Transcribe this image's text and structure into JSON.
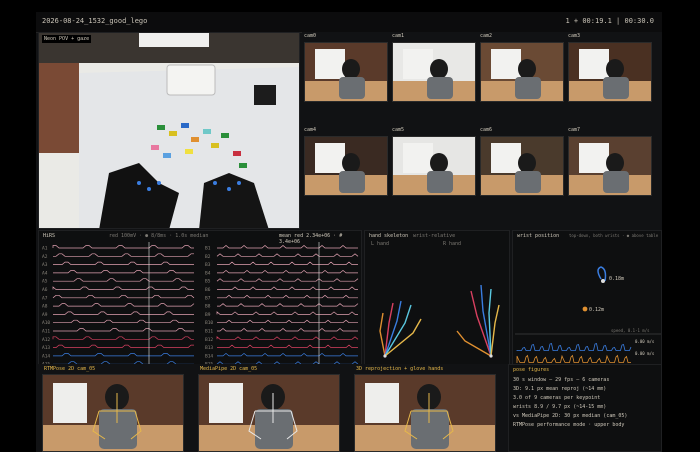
{
  "header": {
    "title": "2026-08-24_1532_good_lego",
    "time": "1 + 00:19.1  |  00:30.0"
  },
  "pov": {
    "label": "Neon POV + gaze"
  },
  "cameras": [
    "cam0",
    "cam1",
    "cam2",
    "cam3",
    "cam4",
    "cam5",
    "cam6",
    "cam7"
  ],
  "emg": {
    "title": "HiRS",
    "meta": "red 100mV  ·  ● 8/8ms  ·  1.0s median",
    "right_meta": "mean red 2.34e+06   ·  # 3.4e+06",
    "channels_left": [
      "A1",
      "A2",
      "A3",
      "A4",
      "A5",
      "A6",
      "A7",
      "A8",
      "A9",
      "A10",
      "A11",
      "A12",
      "A13",
      "A14",
      "A15"
    ],
    "channels_right": [
      "B1",
      "B2",
      "B3",
      "B4",
      "B5",
      "B6",
      "B7",
      "B8",
      "B9",
      "B10",
      "B11",
      "B12",
      "B13",
      "B14",
      "B15"
    ],
    "ticks": [
      "0s",
      "10s",
      "20s"
    ]
  },
  "skeleton": {
    "title": "hand skeleton",
    "sub": "wrist-relative",
    "left": "L hand",
    "right": "R hand"
  },
  "wrist": {
    "title": "wrist position",
    "sub": "top-down, both wrists  ·  ● above table",
    "tag1": "0.18m",
    "tag2": "0.12m",
    "speed_label": "speed, 0.1-1 m/s",
    "v1": "0.00 m/s",
    "v2": "0.00 m/s"
  },
  "pose_views": [
    {
      "label": "RTMPose 2D  cam_05"
    },
    {
      "label": "MediaPipe 2D  cam_05"
    },
    {
      "label": "3D reprojection + glove hands"
    }
  ],
  "pose_figures": {
    "title": "pose figures",
    "lines": [
      "30 s window  —  29 fps  —  6 cameras",
      "3D: 9.1 px mean reproj (~14 mm)",
      "3.0 of 9 cameras per keypoint",
      "wrists 8.9 / 9.7 px (~14-15 mm)",
      "vs MediaPipe 2D: 30 px median (cam_05)",
      "RTMPose performance mode  ·  upper body"
    ]
  },
  "colors": {
    "accent": "#e6b84a",
    "pink": "#e0a0b0",
    "blue": "#3a7de0"
  }
}
